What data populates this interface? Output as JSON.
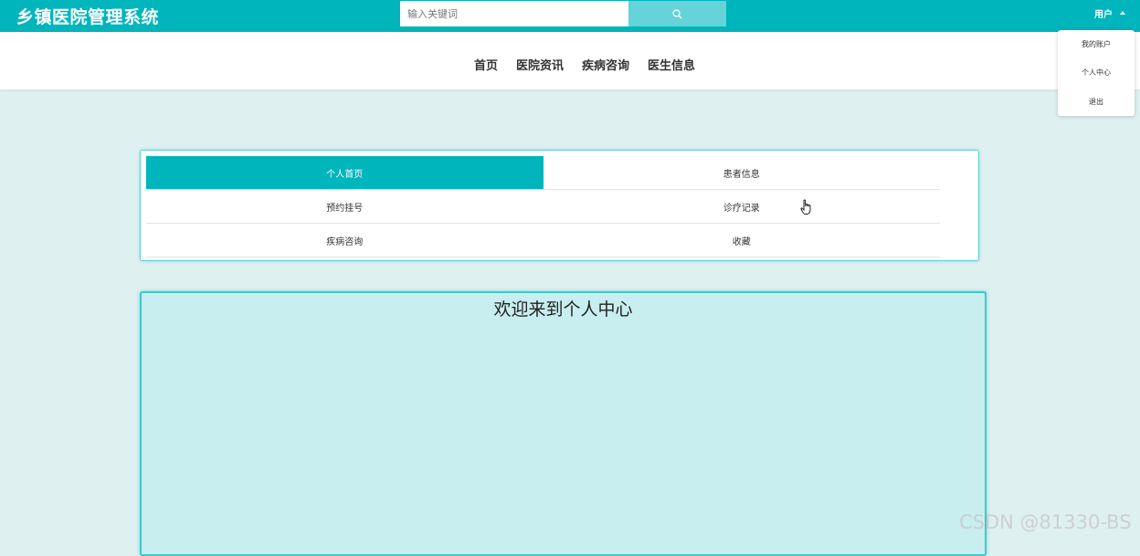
{
  "header": {
    "brand": "乡镇医院管理系统",
    "search_placeholder": "输入关键词",
    "search_icon": "search-icon",
    "user_label": "用户"
  },
  "nav": {
    "items": [
      "首页",
      "医院资讯",
      "疾病咨询",
      "医生信息"
    ]
  },
  "user_dropdown": {
    "items": [
      "我的账户",
      "个人中心",
      "退出"
    ]
  },
  "center_menu": {
    "rows": [
      [
        "个人首页",
        "患者信息"
      ],
      [
        "预约挂号",
        "诊疗记录"
      ],
      [
        "疾病咨询",
        "收藏"
      ]
    ],
    "active": "个人首页"
  },
  "content": {
    "title": "欢迎来到个人中心"
  },
  "watermark": "CSDN @81330-BS",
  "colors": {
    "primary": "#00b5bb",
    "search_button": "#66d3d8",
    "page_bg": "#dff0f0",
    "panel_bg": "#c8eeef"
  }
}
